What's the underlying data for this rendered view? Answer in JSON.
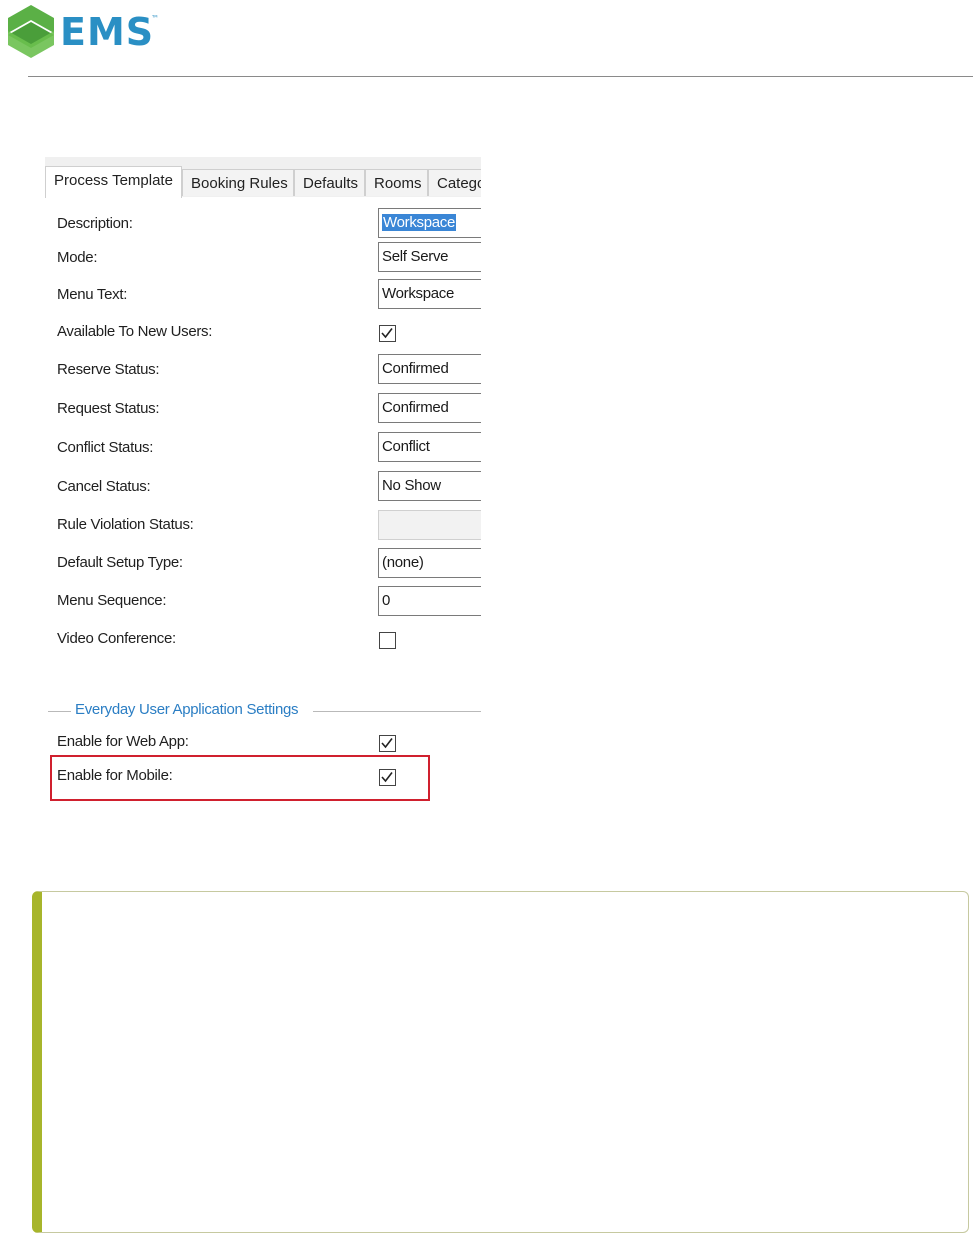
{
  "header": {
    "logo_text": "EMS",
    "logo_tm": "™",
    "logo_color": "#2a8fc4",
    "logo_mark_color": "#5bb046"
  },
  "dialog": {
    "tabs": [
      {
        "label": "Process Template",
        "active": true
      },
      {
        "label": "Booking Rules",
        "active": false
      },
      {
        "label": "Defaults",
        "active": false
      },
      {
        "label": "Rooms",
        "active": false
      },
      {
        "label": "Catego",
        "active": false
      }
    ],
    "fields": {
      "description": {
        "label": "Description:",
        "value": "Workspace"
      },
      "mode": {
        "label": "Mode:",
        "value": "Self Serve"
      },
      "menu_text": {
        "label": "Menu Text:",
        "value": "Workspace"
      },
      "available_new_users": {
        "label": "Available To New Users:",
        "checked": true
      },
      "reserve_status": {
        "label": "Reserve Status:",
        "value": "Confirmed"
      },
      "request_status": {
        "label": "Request Status:",
        "value": "Confirmed"
      },
      "conflict_status": {
        "label": "Conflict Status:",
        "value": "Conflict"
      },
      "cancel_status": {
        "label": "Cancel Status:",
        "value": "No Show"
      },
      "rule_violation_status": {
        "label": "Rule Violation Status:",
        "value": ""
      },
      "default_setup_type": {
        "label": "Default Setup Type:",
        "value": "(none)"
      },
      "menu_sequence": {
        "label": "Menu Sequence:",
        "value": "0"
      },
      "video_conference": {
        "label": "Video Conference:",
        "checked": false
      }
    },
    "group": {
      "title": "Everyday User Application Settings",
      "enable_web_app": {
        "label": "Enable for Web App:",
        "checked": true
      },
      "enable_mobile": {
        "label": "Enable for Mobile:",
        "checked": true
      }
    },
    "highlight_color": "#d0202e"
  },
  "note": {
    "accent_color": "#a7b52b"
  }
}
